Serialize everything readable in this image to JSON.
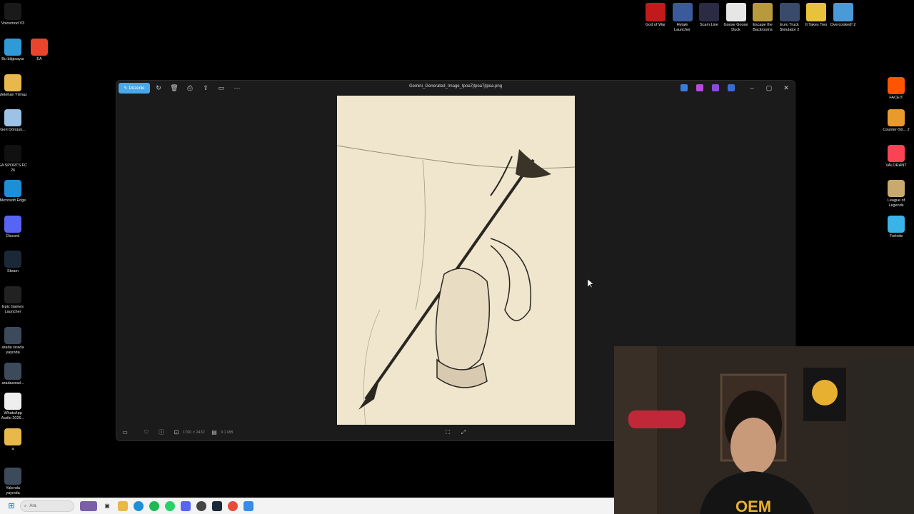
{
  "desktop": {
    "left_icons": [
      {
        "label": "Voicemod V3",
        "icon": "voicemod-icon",
        "color": "#1a1a1a"
      },
      {
        "label": "Bu bilgisayar",
        "icon": "computer-icon",
        "color": "#2f9bd6"
      },
      {
        "label": "EA",
        "icon": "ea-icon",
        "color": "#e8452c"
      },
      {
        "label": "Metehan Yılmaz",
        "icon": "folder-icon",
        "color": "#e8b94a"
      },
      {
        "label": "Geri Dönüşü...",
        "icon": "recycle-bin-icon",
        "color": "#9cc3e6"
      },
      {
        "label": "EA SPORTS FC 26",
        "icon": "ea-sports-icon",
        "color": "#111"
      },
      {
        "label": "Microsoft Edge",
        "icon": "edge-icon",
        "color": "#1e8fd6"
      },
      {
        "label": "Discord",
        "icon": "discord-icon",
        "color": "#5865f2"
      },
      {
        "label": "Steam",
        "icon": "steam-icon",
        "color": "#1b2838"
      },
      {
        "label": "Epic Games Launcher",
        "icon": "epic-games-icon",
        "color": "#222"
      },
      {
        "label": "arada sırada yayında",
        "icon": "video-file-icon",
        "color": "#3c4a5c"
      },
      {
        "label": "aradasırad...",
        "icon": "video-file-icon",
        "color": "#3c4a5c"
      },
      {
        "label": "WhatsApp Audio 2026...",
        "icon": "audio-file-icon",
        "color": "#eeeeee"
      },
      {
        "label": "a",
        "icon": "folder-icon",
        "color": "#e8b94a"
      },
      {
        "label": "Yakında yayında",
        "icon": "video-file-icon",
        "color": "#3c4a5c"
      }
    ],
    "top_icons": [
      {
        "label": "God of War",
        "icon": "god-of-war-icon",
        "color": "#c21a1a"
      },
      {
        "label": "Hytale Launcher",
        "icon": "hytale-icon",
        "color": "#3a5a9c"
      },
      {
        "label": "Scam Line",
        "icon": "scam-line-icon",
        "color": "#2b2b44"
      },
      {
        "label": "Goose Goose Duck",
        "icon": "goose-goose-duck-icon",
        "color": "#e6e6e6"
      },
      {
        "label": "Escape the Backrooms",
        "icon": "escape-backrooms-icon",
        "color": "#b89a3c"
      },
      {
        "label": "Euro Truck Simulator 2",
        "icon": "euro-truck-icon",
        "color": "#3a4a6a"
      },
      {
        "label": "It Takes Two",
        "icon": "it-takes-two-icon",
        "color": "#e8c23a"
      },
      {
        "label": "Overcooked! 2",
        "icon": "overcooked-icon",
        "color": "#4a9ad8"
      }
    ],
    "right_icons": [
      {
        "label": "FACEIT",
        "icon": "faceit-icon",
        "color": "#ff5500"
      },
      {
        "label": "Counter-Str... 2",
        "icon": "counter-strike-icon",
        "color": "#e89a2c"
      },
      {
        "label": "VALORANT",
        "icon": "valorant-icon",
        "color": "#fa4454"
      },
      {
        "label": "League of Legends",
        "icon": "league-icon",
        "color": "#c8aa6e"
      },
      {
        "label": "Fortnite",
        "icon": "fortnite-icon",
        "color": "#3ab4e8"
      }
    ]
  },
  "photos_window": {
    "edit_label": "Düzenle",
    "file_name": "Gemini_Generated_Image_tpoa7jtpoa7jtpoa.png",
    "image_dimensions": "1760 × 2432",
    "file_size": "9.1 MB"
  },
  "taskbar": {
    "search_placeholder": "Ara"
  }
}
